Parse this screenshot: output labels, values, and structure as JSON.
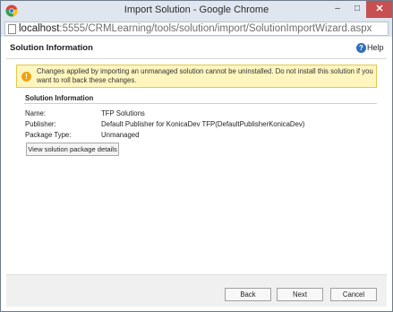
{
  "window": {
    "title": "Import Solution - Google Chrome",
    "controls": {
      "minimize": "–",
      "maximize": "□",
      "close": "✕"
    }
  },
  "address_bar": {
    "host": "localhost",
    "path": ":5555/CRMLearning/tools/solution/import/SolutionImportWizard.aspx"
  },
  "page": {
    "header_title": "Solution Information",
    "help_label": "Help",
    "warning_text": "Changes applied by importing an unmanaged solution cannot be uninstalled. Do not install this solution if you want to roll back these changes.",
    "section_title": "Solution Information",
    "fields": [
      {
        "label": "Name:",
        "value": "TFP Solutions"
      },
      {
        "label": "Publisher:",
        "value": "Default Publisher for KonicaDev TFP(DefaultPublisherKonicaDev)"
      },
      {
        "label": "Package Type:",
        "value": "Unmanaged"
      }
    ],
    "details_button": "View solution package details"
  },
  "footer": {
    "back": "Back",
    "next": "Next",
    "cancel": "Cancel"
  },
  "icons": {
    "app": "chrome-icon",
    "page": "page-icon",
    "help": "help-icon",
    "warning": "warning-icon"
  },
  "colors": {
    "titlebar": "#dfe6ef",
    "close_button": "#c75050",
    "warning_background": "#fff6bf",
    "warning_icon": "#f0a30a",
    "help_icon": "#2f6fb6"
  }
}
